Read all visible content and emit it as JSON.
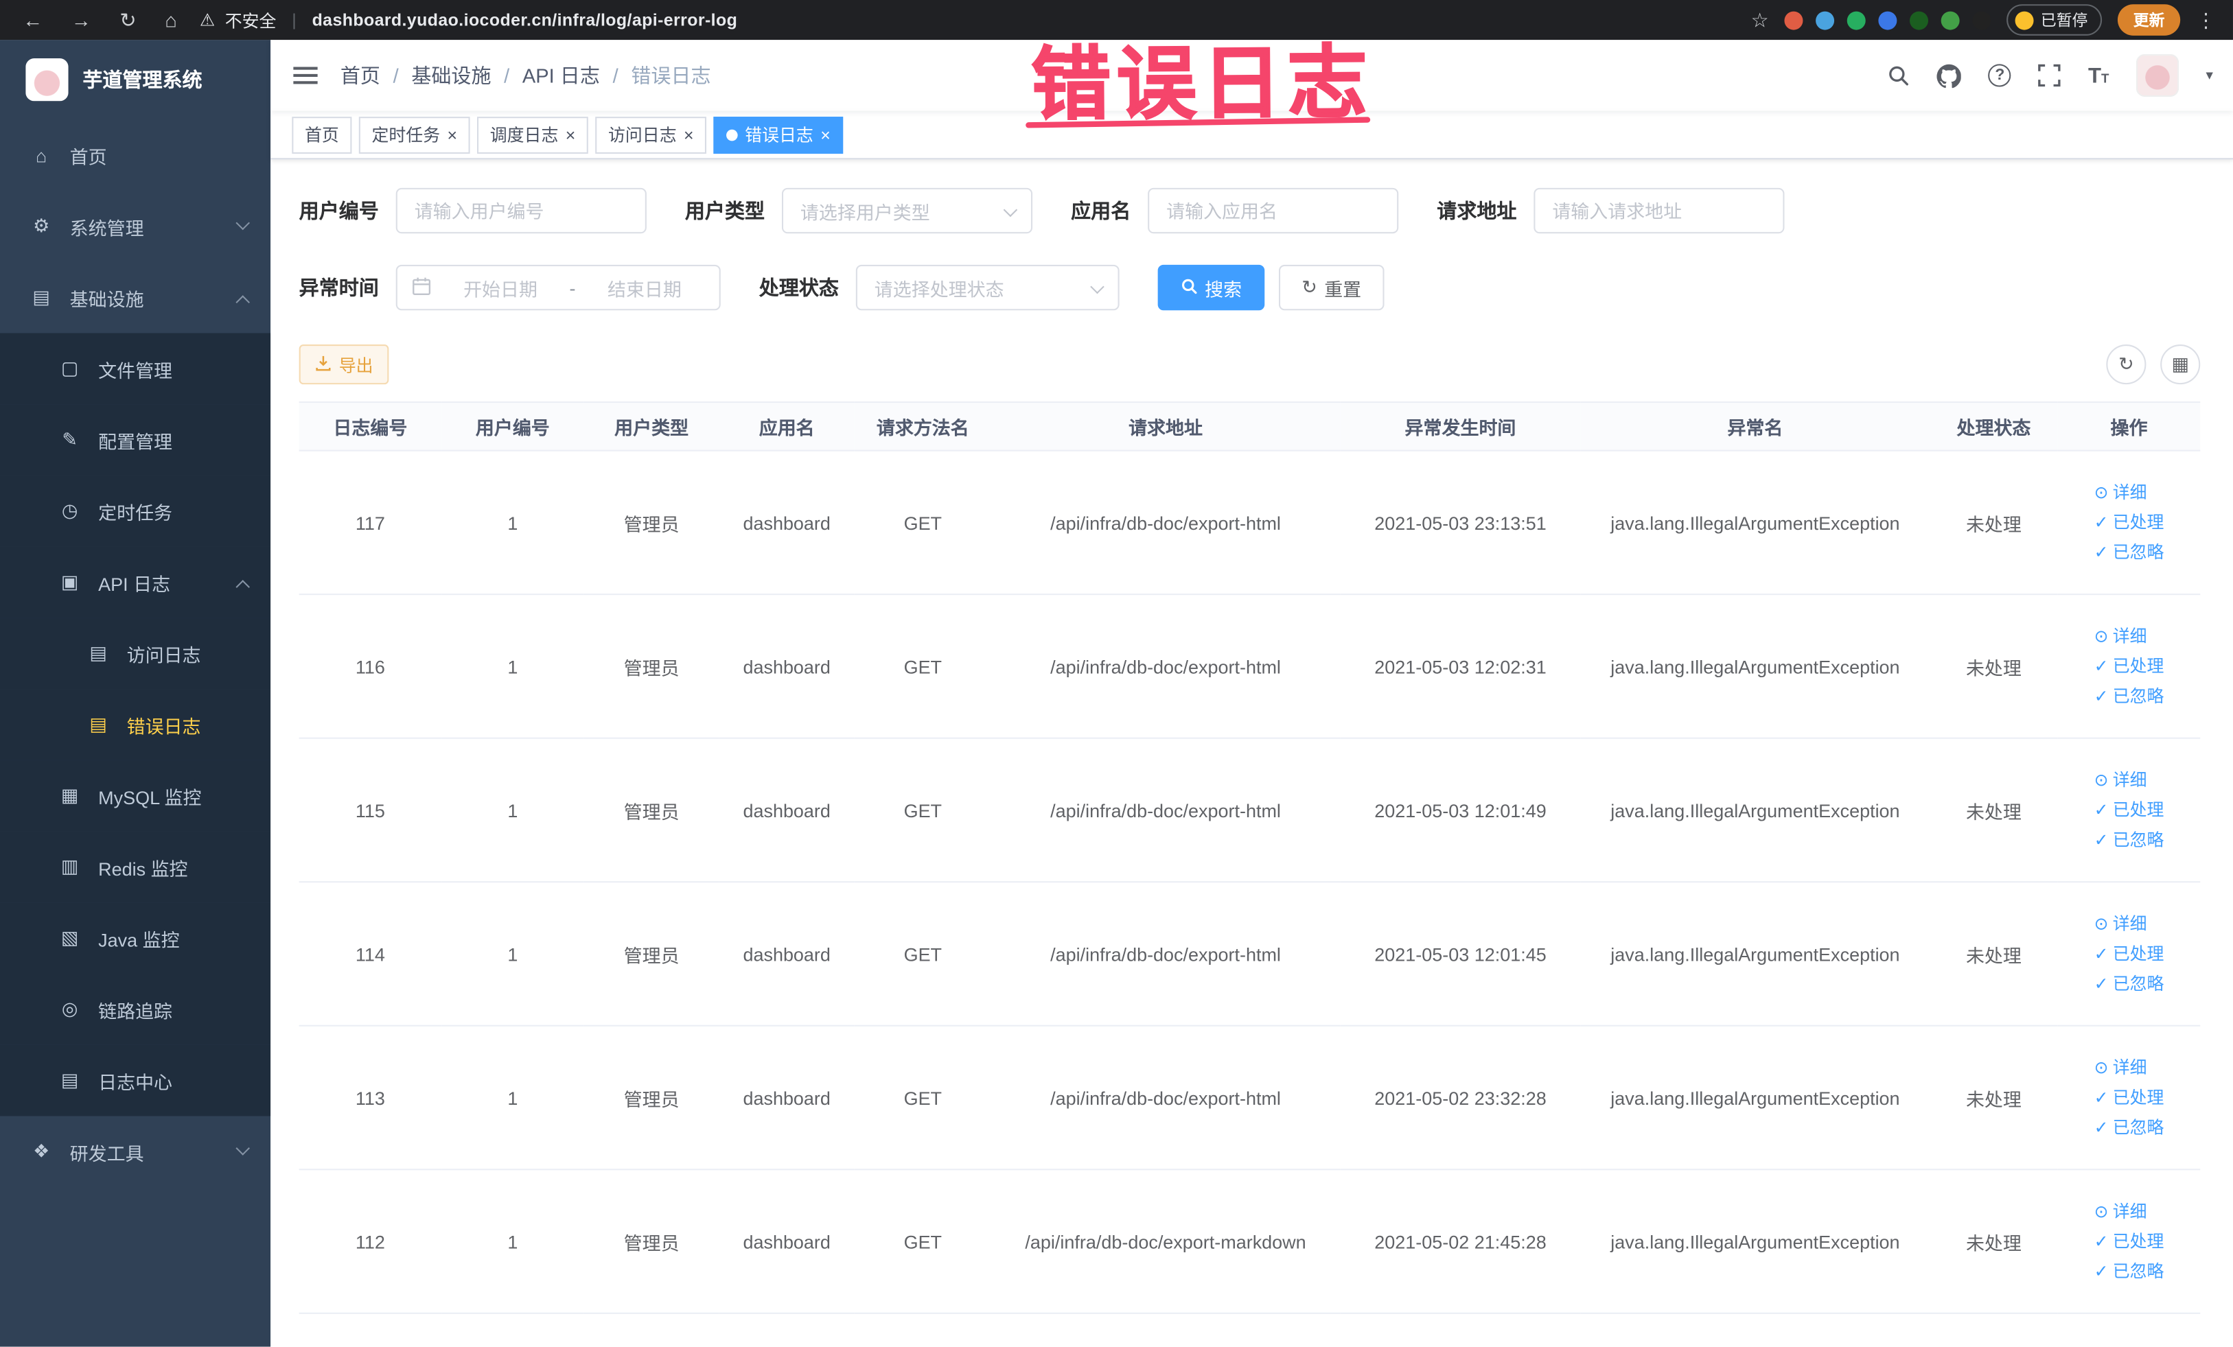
{
  "colors": {
    "accent": "#409eff",
    "sidebar_active": "#ffd04b",
    "warning": "#e6a23c",
    "annotation": "#f5456b"
  },
  "icon_glyphs": {
    "back-icon": "←",
    "forward-icon": "→",
    "reload-icon": "↻",
    "home-nav-icon": "⌂",
    "warning-icon": "⚠",
    "star-icon": "☆",
    "more-icon": "⋮",
    "caret-down-icon": "▾",
    "help-icon": "?",
    "font-size-icon": "T",
    "home-icon": "⌂",
    "gear-icon": "⚙",
    "infra-icon": "▤",
    "file-icon": "▢",
    "config-icon": "✎",
    "job-icon": "◷",
    "api-log-icon": "▣",
    "access-log-icon": "▤",
    "error-log-icon": "▤",
    "mysql-icon": "▦",
    "redis-icon": "▥",
    "java-icon": "▧",
    "trace-icon": "◎",
    "log-center-icon": "▤",
    "tools-icon": "❖",
    "refresh-icon": "↻",
    "columns-icon": "▦",
    "view-icon": "⊙",
    "check-icon": "✓",
    "close-icon": "×"
  },
  "browser": {
    "security_label": "不安全",
    "url": "dashboard.yudao.iocoder.cn/infra/log/api-error-log",
    "paused_badge": "已暂停",
    "update_label": "更新",
    "extensions": [
      {
        "name": "extension-icon",
        "color": "#e05d44"
      },
      {
        "name": "extension-icon",
        "color": "#4aa3df"
      },
      {
        "name": "extension-icon",
        "color": "#27ae60"
      },
      {
        "name": "extension-icon",
        "color": "#3b78e7"
      },
      {
        "name": "extension-icon",
        "color": "#1b5e20"
      },
      {
        "name": "extension-icon",
        "color": "#43a047"
      },
      {
        "name": "extension-icon",
        "color": "#222222"
      }
    ]
  },
  "annotation": {
    "text": "错误日志"
  },
  "sidebar": {
    "logo_title": "芋道管理系统",
    "menu": [
      {
        "id": "home",
        "label": "首页",
        "icon": "home-icon",
        "level": 1
      },
      {
        "id": "system",
        "label": "系统管理",
        "icon": "gear-icon",
        "level": 1,
        "expandable": true,
        "expanded": false
      },
      {
        "id": "infra",
        "label": "基础设施",
        "icon": "infra-icon",
        "level": 1,
        "expandable": true,
        "expanded": true
      },
      {
        "id": "file",
        "label": "文件管理",
        "icon": "file-icon",
        "level": 2
      },
      {
        "id": "config",
        "label": "配置管理",
        "icon": "config-icon",
        "level": 2
      },
      {
        "id": "job",
        "label": "定时任务",
        "icon": "job-icon",
        "level": 2
      },
      {
        "id": "api-log",
        "label": "API 日志",
        "icon": "api-log-icon",
        "level": 2,
        "expandable": true,
        "expanded": true
      },
      {
        "id": "access-log",
        "label": "访问日志",
        "icon": "access-log-icon",
        "level": 3
      },
      {
        "id": "error-log",
        "label": "错误日志",
        "icon": "error-log-icon",
        "level": 3,
        "active": true
      },
      {
        "id": "mysql",
        "label": "MySQL 监控",
        "icon": "mysql-icon",
        "level": 2
      },
      {
        "id": "redis",
        "label": "Redis 监控",
        "icon": "redis-icon",
        "level": 2
      },
      {
        "id": "java",
        "label": "Java 监控",
        "icon": "java-icon",
        "level": 2
      },
      {
        "id": "trace",
        "label": "链路追踪",
        "icon": "trace-icon",
        "level": 2
      },
      {
        "id": "log-center",
        "label": "日志中心",
        "icon": "log-center-icon",
        "level": 2
      },
      {
        "id": "devtools",
        "label": "研发工具",
        "icon": "tools-icon",
        "level": 1,
        "expandable": true,
        "expanded": false
      }
    ]
  },
  "breadcrumb": {
    "items": [
      "首页",
      "基础设施",
      "API 日志",
      "错误日志"
    ]
  },
  "tabs": [
    {
      "label": "首页",
      "closable": false,
      "active": false
    },
    {
      "label": "定时任务",
      "closable": true,
      "active": false
    },
    {
      "label": "调度日志",
      "closable": true,
      "active": false
    },
    {
      "label": "访问日志",
      "closable": true,
      "active": false
    },
    {
      "label": "错误日志",
      "closable": true,
      "active": true
    }
  ],
  "filters": {
    "user_id": {
      "label": "用户编号",
      "placeholder": "请输入用户编号"
    },
    "user_type": {
      "label": "用户类型",
      "placeholder": "请选择用户类型"
    },
    "app_name": {
      "label": "应用名",
      "placeholder": "请输入应用名"
    },
    "request_url": {
      "label": "请求地址",
      "placeholder": "请输入请求地址"
    },
    "exception_time": {
      "label": "异常时间",
      "start_placeholder": "开始日期",
      "separator": "-",
      "end_placeholder": "结束日期"
    },
    "process_status": {
      "label": "处理状态",
      "placeholder": "请选择处理状态"
    },
    "search_label": "搜索",
    "reset_label": "重置"
  },
  "toolbar": {
    "export_label": "导出"
  },
  "table": {
    "columns": [
      "日志编号",
      "用户编号",
      "用户类型",
      "应用名",
      "请求方法名",
      "请求地址",
      "异常发生时间",
      "异常名",
      "处理状态",
      "操作"
    ],
    "action_labels": {
      "detail": "详细",
      "processed": "已处理",
      "ignored": "已忽略"
    },
    "rows": [
      {
        "log_id": "117",
        "user_id": "1",
        "user_type": "管理员",
        "app_name": "dashboard",
        "method": "GET",
        "url": "/api/infra/db-doc/export-html",
        "time": "2021-05-03 23:13:51",
        "exception": "java.lang.IllegalArgumentException",
        "status": "未处理"
      },
      {
        "log_id": "116",
        "user_id": "1",
        "user_type": "管理员",
        "app_name": "dashboard",
        "method": "GET",
        "url": "/api/infra/db-doc/export-html",
        "time": "2021-05-03 12:02:31",
        "exception": "java.lang.IllegalArgumentException",
        "status": "未处理"
      },
      {
        "log_id": "115",
        "user_id": "1",
        "user_type": "管理员",
        "app_name": "dashboard",
        "method": "GET",
        "url": "/api/infra/db-doc/export-html",
        "time": "2021-05-03 12:01:49",
        "exception": "java.lang.IllegalArgumentException",
        "status": "未处理"
      },
      {
        "log_id": "114",
        "user_id": "1",
        "user_type": "管理员",
        "app_name": "dashboard",
        "method": "GET",
        "url": "/api/infra/db-doc/export-html",
        "time": "2021-05-03 12:01:45",
        "exception": "java.lang.IllegalArgumentException",
        "status": "未处理"
      },
      {
        "log_id": "113",
        "user_id": "1",
        "user_type": "管理员",
        "app_name": "dashboard",
        "method": "GET",
        "url": "/api/infra/db-doc/export-html",
        "time": "2021-05-02 23:32:28",
        "exception": "java.lang.IllegalArgumentException",
        "status": "未处理"
      },
      {
        "log_id": "112",
        "user_id": "1",
        "user_type": "管理员",
        "app_name": "dashboard",
        "method": "GET",
        "url": "/api/infra/db-doc/export-markdown",
        "time": "2021-05-02 21:45:28",
        "exception": "java.lang.IllegalArgumentException",
        "status": "未处理"
      }
    ]
  }
}
